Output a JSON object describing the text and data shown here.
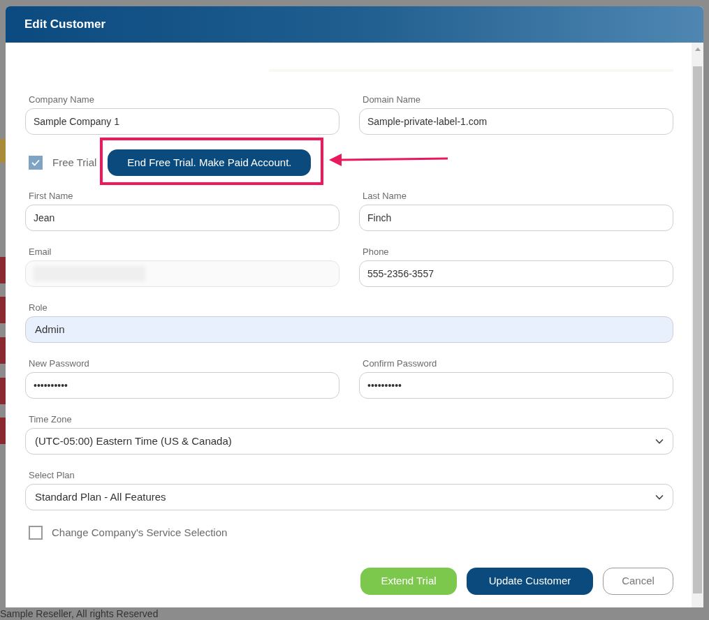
{
  "dialog": {
    "title": "Edit Customer",
    "field_rows": [
      [
        {
          "kind": "text",
          "label": "Company Name",
          "value": "Sample Company 1",
          "disabled": false
        },
        {
          "kind": "text",
          "label": "Domain Name",
          "value": "Sample-private-label-1.com",
          "disabled": false
        }
      ],
      [
        {
          "kind": "trial"
        }
      ],
      [
        {
          "kind": "text",
          "label": "First Name",
          "value": "Jean",
          "disabled": false
        },
        {
          "kind": "text",
          "label": "Last Name",
          "value": "Finch",
          "disabled": false
        }
      ],
      [
        {
          "kind": "text",
          "label": "Email",
          "redacted": true,
          "disabled": true
        },
        {
          "kind": "text",
          "label": "Phone",
          "value": "555-2356-3557",
          "disabled": false
        }
      ],
      [
        {
          "kind": "highlighted",
          "label": "Role",
          "value": "Admin",
          "disabled": false
        }
      ],
      [
        {
          "kind": "text",
          "label": "New Password",
          "value": "••••••••••",
          "disabled": false
        },
        {
          "kind": "text",
          "label": "Confirm Password",
          "value": "••••••••••",
          "disabled": false
        }
      ],
      [
        {
          "kind": "select",
          "label": "Time Zone",
          "value": "(UTC-05:00) Eastern Time (US & Canada)",
          "disabled": false
        }
      ],
      [
        {
          "kind": "select",
          "label": "Select Plan",
          "value": "Standard Plan - All Features",
          "disabled": false
        }
      ]
    ],
    "free_trial": {
      "label": "Free Trial",
      "checked": true,
      "button": "End Free Trial. Make Paid Account."
    },
    "service_selection": {
      "label": "Change Company's Service Selection",
      "checked": false
    },
    "buttons": [
      {
        "label": "Extend Trial",
        "kind": "success"
      },
      {
        "label": "Update Customer",
        "kind": "primary"
      },
      {
        "label": "Cancel",
        "kind": "secondary"
      }
    ]
  },
  "footer_text": "Sample Reseller, All rights Reserved"
}
